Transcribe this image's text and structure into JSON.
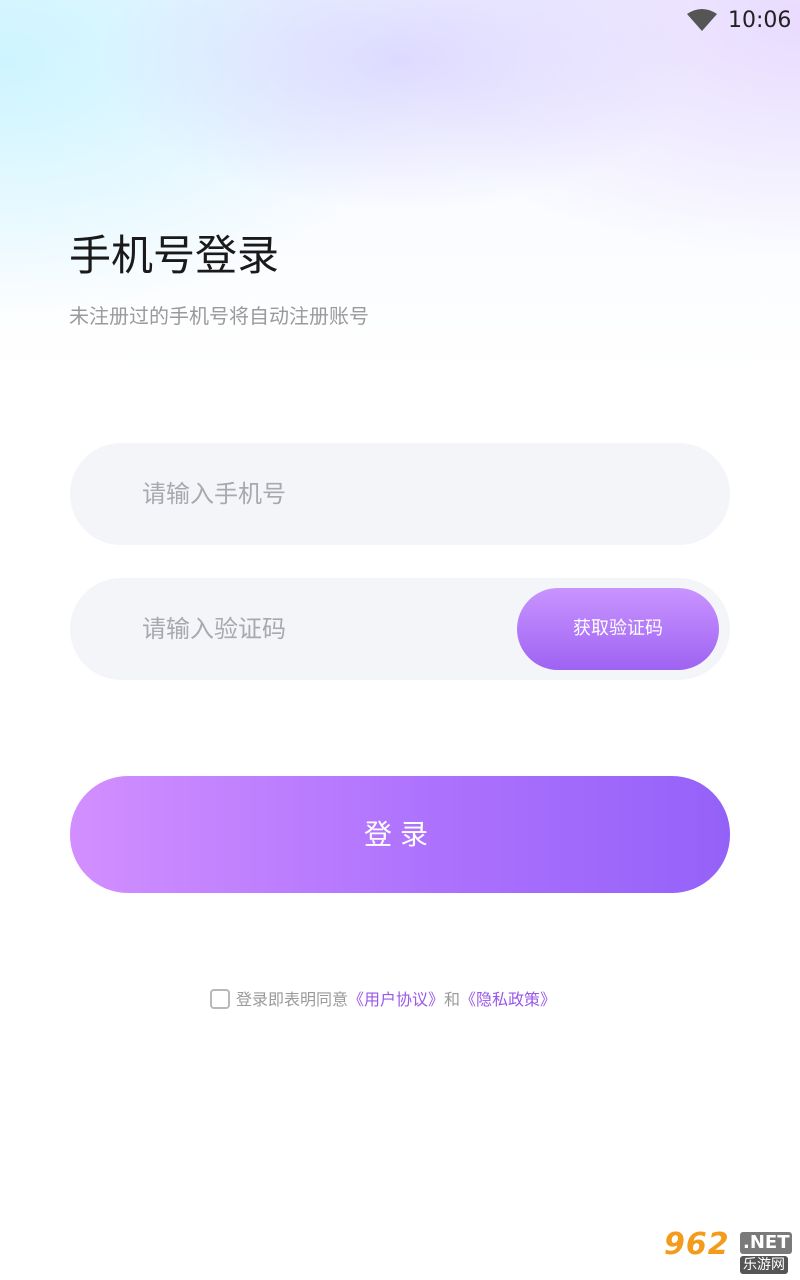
{
  "status_bar": {
    "time": "10:06",
    "wifi_icon": "wifi-icon"
  },
  "header": {
    "title": "手机号登录",
    "subtitle": "未注册过的手机号将自动注册账号"
  },
  "form": {
    "phone_placeholder": "请输入手机号",
    "phone_value": "",
    "code_placeholder": "请输入验证码",
    "code_value": "",
    "get_code_label": "获取验证码",
    "login_label": "登录"
  },
  "agreement": {
    "checked": false,
    "prefix": "登录即表明同意",
    "user_agreement": "《用户协议》",
    "conjunction": "和",
    "privacy_policy": "《隐私政策》"
  },
  "watermark": {
    "number": "962",
    "suffix": ".NET",
    "caption": "乐游网"
  },
  "colors": {
    "accent_start": "#d28fff",
    "accent_end": "#9461f8",
    "link": "#9b57e9",
    "field_bg": "#f4f5f9"
  }
}
